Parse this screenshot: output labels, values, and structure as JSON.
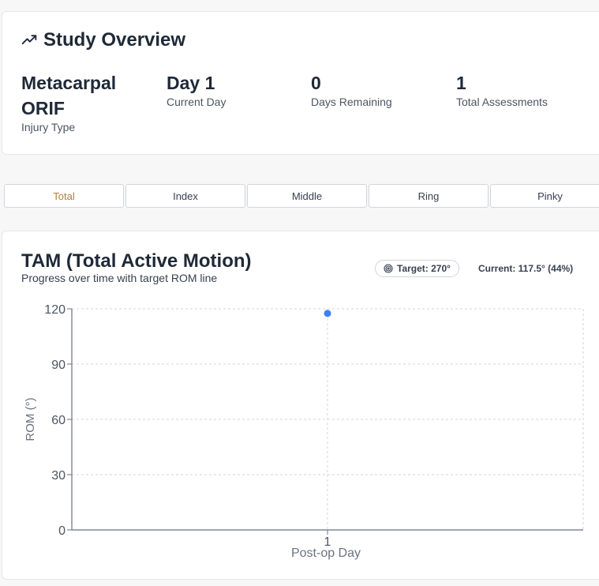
{
  "overview": {
    "title": "Study Overview",
    "icon": "trending-up-icon",
    "stats": [
      {
        "value": "Metacarpal ORIF",
        "label": "Injury Type"
      },
      {
        "value": "Day 1",
        "label": "Current Day"
      },
      {
        "value": "0",
        "label": "Days Remaining"
      },
      {
        "value": "1",
        "label": "Total Assessments"
      }
    ]
  },
  "tabs": [
    {
      "label": "Total",
      "active": true
    },
    {
      "label": "Index",
      "active": false
    },
    {
      "label": "Middle",
      "active": false
    },
    {
      "label": "Ring",
      "active": false
    },
    {
      "label": "Pinky",
      "active": false
    }
  ],
  "chart_card": {
    "title": "TAM (Total Active Motion)",
    "subtitle": "Progress over time with target ROM line",
    "target_label": "Target: 270°",
    "current_label": "Current: 117.5° (44%)"
  },
  "colors": {
    "accent": "#b07d3f",
    "point": "#3b82f6",
    "grid": "#d1d5db"
  },
  "chart_data": {
    "type": "scatter",
    "xlabel": "Post-op Day",
    "ylabel": "ROM (°)",
    "ylim": [
      0,
      120
    ],
    "yticks": [
      0,
      30,
      60,
      90,
      120
    ],
    "xticks": [
      1
    ],
    "series": [
      {
        "x": [
          1
        ],
        "y": [
          117.5
        ]
      }
    ],
    "grid": true
  }
}
